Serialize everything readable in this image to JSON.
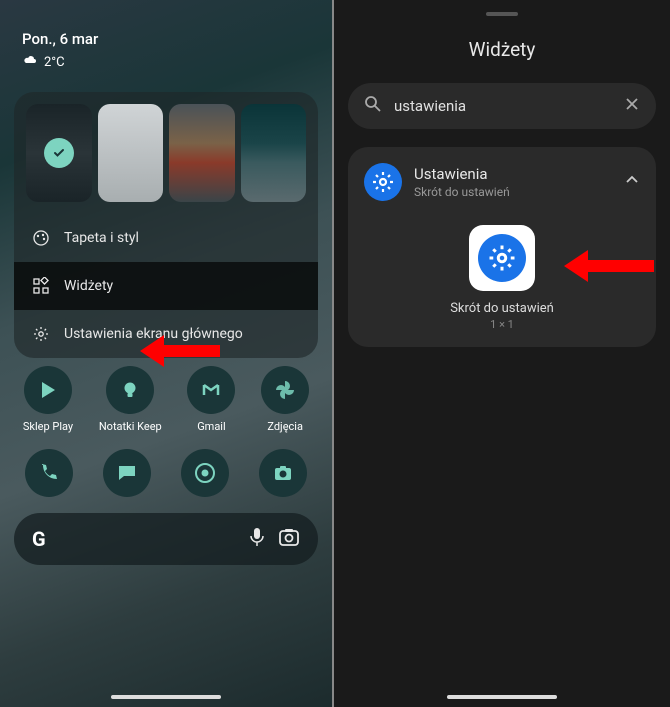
{
  "left": {
    "date": "Pon., 6 mar",
    "temp": "2°C",
    "menu": {
      "wallpaper": "Tapeta i styl",
      "widgets": "Widżety",
      "home_settings": "Ustawienia ekranu głównego"
    },
    "apps": {
      "play": "Sklep Play",
      "keep": "Notatki Keep",
      "gmail": "Gmail",
      "photos": "Zdjęcia"
    },
    "search_letter": "G"
  },
  "right": {
    "title": "Widżety",
    "search_value": "ustawienia",
    "group": {
      "title": "Ustawienia",
      "subtitle": "Skrót do ustawień"
    },
    "widget": {
      "label": "Skrót do ustawień",
      "size": "1 × 1"
    }
  }
}
